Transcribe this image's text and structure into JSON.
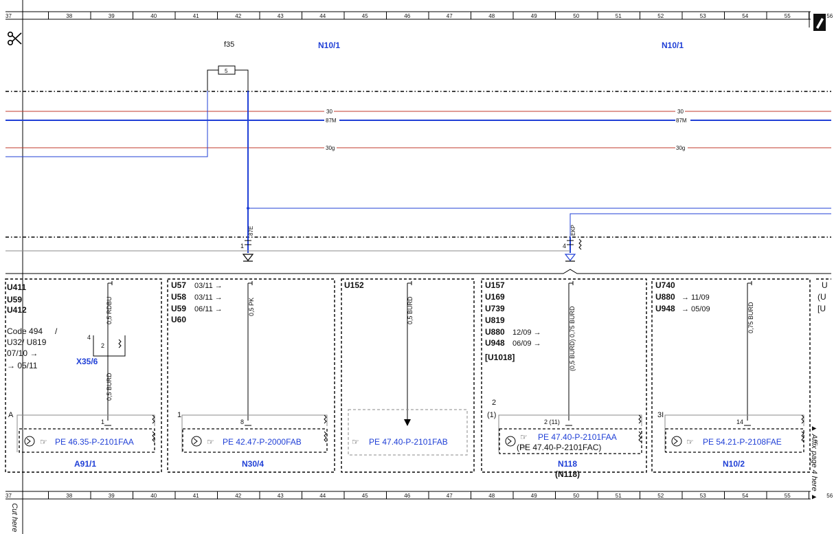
{
  "sheet": {
    "ruler_numbers": [
      "37",
      "38",
      "39",
      "40",
      "41",
      "42",
      "43",
      "44",
      "45",
      "46",
      "47",
      "48",
      "49",
      "50",
      "51",
      "52",
      "53",
      "54",
      "55",
      "56"
    ],
    "cut_here": "Cut here",
    "affix_note": "▲ Affix page 4 here ▲"
  },
  "top": {
    "fuse_label": "f35",
    "fuse_number": "5",
    "module_labels": [
      "N10/1",
      "N10/1"
    ]
  },
  "buses": {
    "b30": "30",
    "b87m": "87M",
    "b30g": "30g"
  },
  "wires": {
    "w87e": "87E",
    "wekp": "EKP",
    "pin_left": "1",
    "pin_right": "4"
  },
  "s1": {
    "codes": [
      "U411",
      "U59",
      "U412"
    ],
    "code494": "Code 494",
    "slash": "/",
    "u32": "U32/ U819",
    "date1": "07/10 →",
    "date2": "→ 05/11",
    "conn": "X35/6",
    "conn_pin4": "4",
    "conn_pin2": "2",
    "wire_top": "0,5 RDBU",
    "wire_bot": "0,5 BURD",
    "corner": "A",
    "pin": "1",
    "ref": "PE 46.35-P-2101FAA",
    "comp": "A91/1"
  },
  "s2": {
    "codes": [
      {
        "code": "U57",
        "date": "03/11 →"
      },
      {
        "code": "U58",
        "date": "03/11 →"
      },
      {
        "code": "U59",
        "date": "06/11 →"
      },
      {
        "code": "U60",
        "date": ""
      }
    ],
    "wire": "0,5 PK",
    "corner": "1",
    "pin": "8",
    "ref": "PE 42.47-P-2000FAB",
    "comp": "N30/4"
  },
  "s3": {
    "code": "U152",
    "wire": "0,5 BURD",
    "ref": "PE 47.40-P-2101FAB"
  },
  "s4": {
    "codes": [
      "U157",
      "U169",
      "U739",
      "U819"
    ],
    "u880": "U880",
    "u880_date": "12/09 →",
    "u948": "U948",
    "u948_date": "06/09 →",
    "u1018": "[U1018]",
    "wire": "(0,5 BURD) 0,75 BURD",
    "corner": "2",
    "corner2": "(1)",
    "pin": "2 (11)",
    "ref1": "PE 47.40-P-2101FAA",
    "ref2": "(PE 47.40-P-2101FAC)",
    "comp": "N118",
    "comp2": "(N118)"
  },
  "s5": {
    "code": "U740",
    "u880": "U880",
    "u880_date": "→ 11/09",
    "u948": "U948",
    "u948_date": "→ 05/09",
    "wire": "0,75 BURD",
    "corner": "3I",
    "pin": "14",
    "ref": "PE 54.21-P-2108FAE",
    "comp": "N10/2"
  },
  "s6": {
    "lines": [
      "U",
      "(U",
      "[U"
    ]
  },
  "colors": {
    "wire_blue": "#1f3fd6",
    "bus_red": "#c0392b",
    "link_blue": "#1f3fd6",
    "frame_gray": "#888888"
  },
  "icons": [
    "scissors-icon",
    "pencil-icon",
    "pointing-hand-icon",
    "ground-symbol-icon"
  ]
}
